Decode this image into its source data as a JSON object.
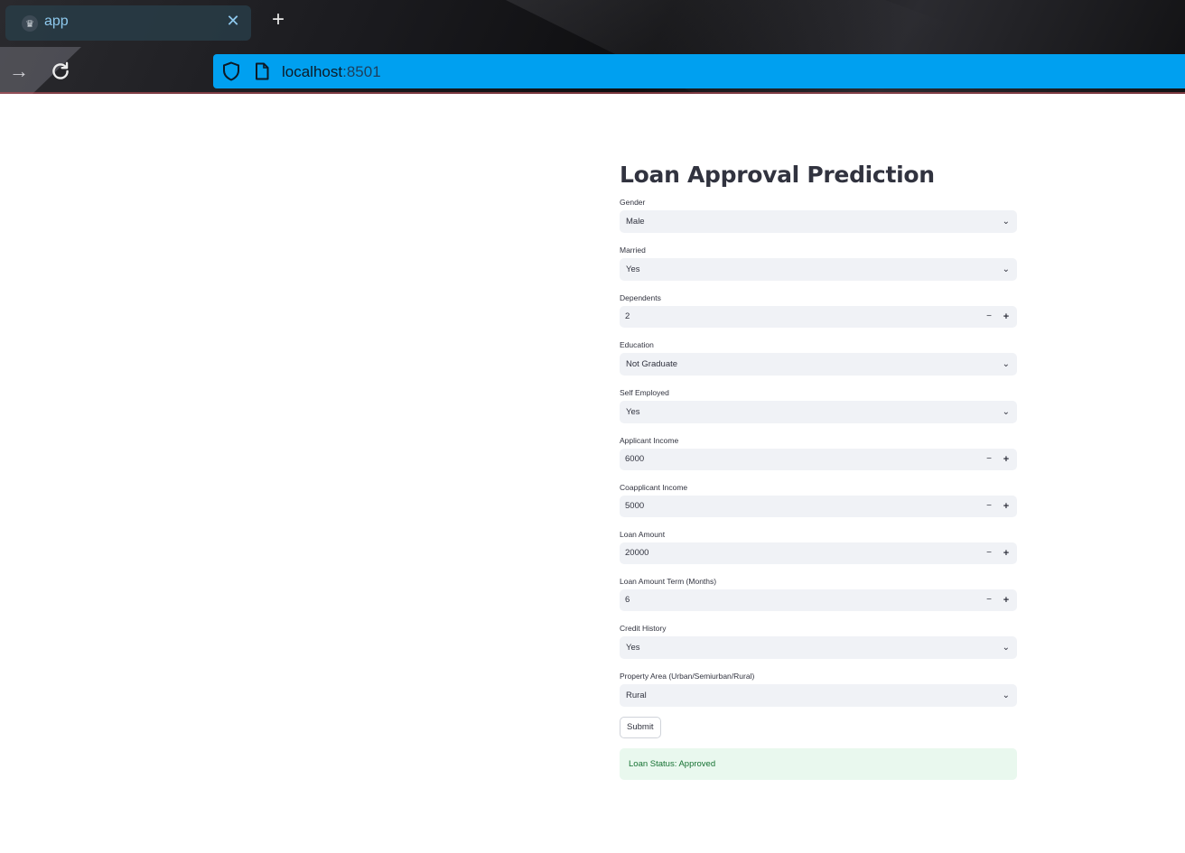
{
  "browser": {
    "tab_title": "app",
    "tab_close": "✕",
    "new_tab": "+",
    "forward": "→",
    "url_host": "localhost",
    "url_port": ":8501",
    "accent_color": "#00a0f0"
  },
  "app": {
    "title": "Loan Approval Prediction",
    "fields": [
      {
        "label": "Gender",
        "type": "select",
        "value": "Male"
      },
      {
        "label": "Married",
        "type": "select",
        "value": "Yes"
      },
      {
        "label": "Dependents",
        "type": "number",
        "value": "2"
      },
      {
        "label": "Education",
        "type": "select",
        "value": "Not Graduate"
      },
      {
        "label": "Self Employed",
        "type": "select",
        "value": "Yes"
      },
      {
        "label": "Applicant Income",
        "type": "number",
        "value": "6000"
      },
      {
        "label": "Coapplicant Income",
        "type": "number",
        "value": "5000"
      },
      {
        "label": "Loan Amount",
        "type": "number",
        "value": "20000"
      },
      {
        "label": "Loan Amount Term (Months)",
        "type": "number",
        "value": "6"
      },
      {
        "label": "Credit History",
        "type": "select",
        "value": "Yes"
      },
      {
        "label": "Property Area (Urban/Semiurban/Rural)",
        "type": "select",
        "value": "Rural"
      }
    ],
    "stepper_minus": "−",
    "stepper_plus": "+",
    "submit_label": "Submit",
    "result": "Loan Status: Approved",
    "result_color": "#177233"
  }
}
